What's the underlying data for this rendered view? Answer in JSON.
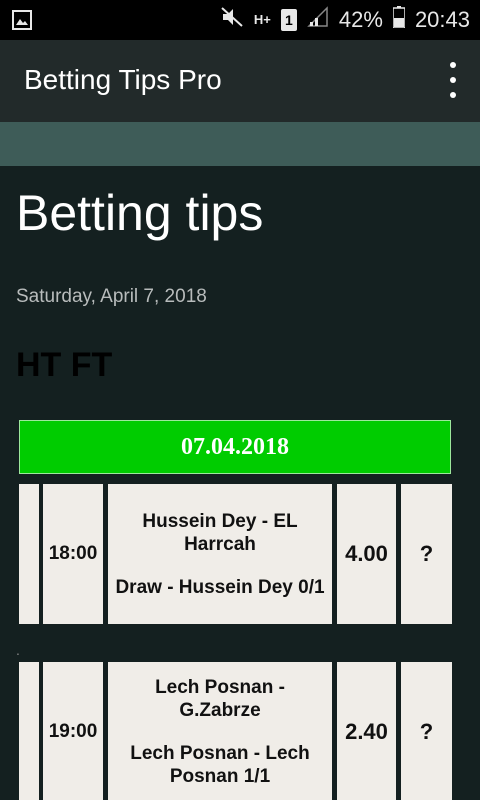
{
  "status_bar": {
    "network_label": "H+",
    "sim_label": "1",
    "battery": "42%",
    "time": "20:43"
  },
  "app_bar": {
    "title": "Betting Tips Pro"
  },
  "page": {
    "title": "Betting tips",
    "date": "Saturday, April 7, 2018",
    "section": "HT FT"
  },
  "table": {
    "date_header": "07.04.2018",
    "rows": [
      {
        "time": "18:00",
        "match": "Hussein Dey - EL Harrcah",
        "tip": "Draw - Hussein Dey 0/1",
        "odds": "4.00",
        "result": "?"
      },
      {
        "time": "19:00",
        "match": "Lech Posnan - G.Zabrze",
        "tip": "Lech Posnan - Lech Posnan 1/1",
        "odds": "2.40",
        "result": "?"
      }
    ],
    "separator": "."
  },
  "colors": {
    "date_header_bg": "#00cc00",
    "app_bar_bg": "#222a2a",
    "banner_strip": "#3e5c58",
    "background": "#142020",
    "cell_bg": "#f0ede8"
  }
}
